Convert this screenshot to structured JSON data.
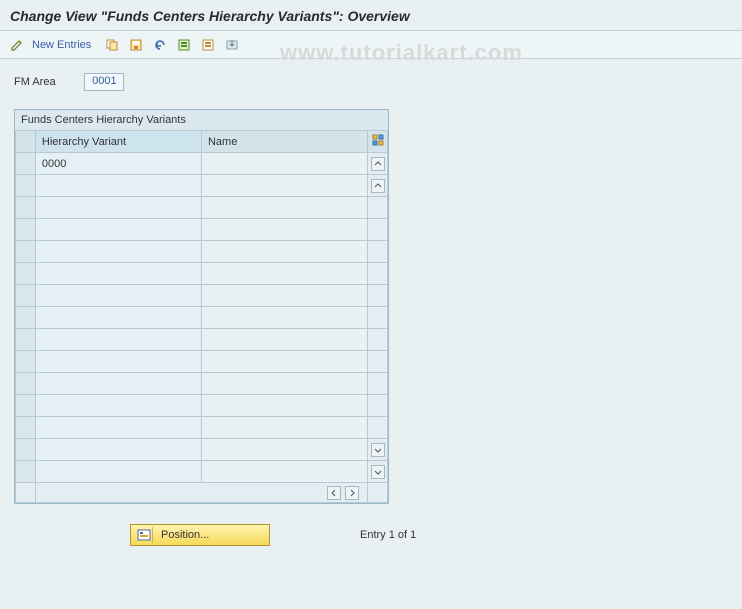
{
  "header": {
    "title": "Change View \"Funds Centers Hierarchy Variants\": Overview"
  },
  "toolbar": {
    "new_entries_label": "New Entries",
    "icons": {
      "change": "pencil-icon",
      "copy": "copy-icon",
      "save": "save-icon",
      "undo": "undo-icon",
      "select_all": "select-all-icon",
      "deselect_all": "deselect-all-icon",
      "import": "import-icon"
    }
  },
  "form": {
    "fm_area_label": "FM Area",
    "fm_area_value": "0001"
  },
  "panel": {
    "caption": "Funds Centers Hierarchy Variants",
    "columns": {
      "hierarchy_variant": "Hierarchy Variant",
      "name": "Name"
    },
    "rows": [
      {
        "hv": "0000",
        "name": ""
      },
      {
        "hv": "",
        "name": ""
      },
      {
        "hv": "",
        "name": ""
      },
      {
        "hv": "",
        "name": ""
      },
      {
        "hv": "",
        "name": ""
      },
      {
        "hv": "",
        "name": ""
      },
      {
        "hv": "",
        "name": ""
      },
      {
        "hv": "",
        "name": ""
      },
      {
        "hv": "",
        "name": ""
      },
      {
        "hv": "",
        "name": ""
      },
      {
        "hv": "",
        "name": ""
      },
      {
        "hv": "",
        "name": ""
      },
      {
        "hv": "",
        "name": ""
      },
      {
        "hv": "",
        "name": ""
      },
      {
        "hv": "",
        "name": ""
      }
    ]
  },
  "footer": {
    "position_label": "Position...",
    "entry_count": "Entry 1 of 1"
  },
  "watermark": {
    "text": "www.tutorialkart.com"
  }
}
